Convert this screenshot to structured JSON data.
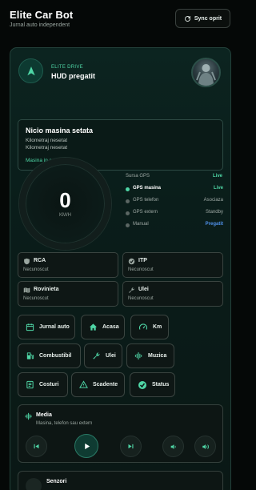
{
  "header": {
    "title": "Elite Car Bot",
    "subtitle": "Jurnal auto independent",
    "sync_label": "Sync oprit"
  },
  "drive": {
    "kicker": "ELITE DRIVE",
    "status": "HUD pregatit"
  },
  "car": {
    "title": "Nicio masina setata",
    "km_line1": "Kilometraj nesetat",
    "km_line2": "Kilometraj nesetat",
    "status": "Masina in regula"
  },
  "speed": {
    "value": "0",
    "unit": "KM/H"
  },
  "gps": {
    "source_label": "Sursa GPS",
    "source_value": "Live",
    "rows": [
      {
        "name": "GPS masina",
        "value": "Live",
        "dot_color": "#4fd6a6",
        "value_color": "#4fd6a6",
        "name_color": "#ffffff"
      },
      {
        "name": "GPS telefon",
        "value": "Asociaza",
        "dot_color": "#5b6663",
        "value_color": "#a0aaa6",
        "name_color": "#a0aaa6"
      },
      {
        "name": "GPS extern",
        "value": "Standby",
        "dot_color": "#5b6663",
        "value_color": "#a0aaa6",
        "name_color": "#a0aaa6"
      },
      {
        "name": "Manual",
        "value": "Pregatit",
        "dot_color": "#5b6663",
        "value_color": "#4f8fe8",
        "name_color": "#a0aaa6"
      }
    ]
  },
  "documents": [
    {
      "title": "RCA",
      "status": "Necunoscut",
      "icon": "shield-icon"
    },
    {
      "title": "ITP",
      "status": "Necunoscut",
      "icon": "check-badge-icon"
    },
    {
      "title": "Rovinieta",
      "status": "Necunoscut",
      "icon": "map-icon"
    },
    {
      "title": "Ulei",
      "status": "Necunoscut",
      "icon": "wrench-icon"
    }
  ],
  "actions": {
    "journal": "Jurnal auto",
    "home": "Acasa",
    "km": "Km",
    "fuel": "Combustibil",
    "oil": "Ulei",
    "music": "Muzica",
    "costs": "Costuri",
    "due": "Scadente",
    "status": "Status"
  },
  "media": {
    "title": "Media",
    "subtitle": "Masina, telefon sau extern"
  },
  "sensors": {
    "title": "Senzori"
  },
  "colors": {
    "accent": "#4fd6a6",
    "link_blue": "#4f8fe8",
    "background": "#050807"
  }
}
